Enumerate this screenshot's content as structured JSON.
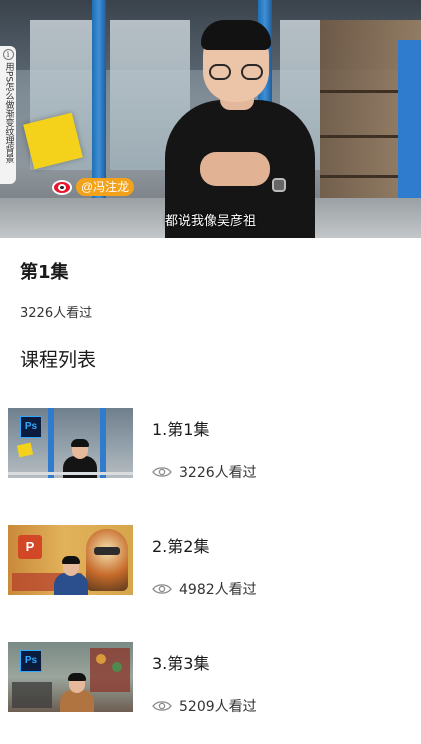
{
  "video": {
    "side_tag": "用PS怎么做渐变纹理背景",
    "watermark": "@冯注龙",
    "subtitle": "都说我像吴彦祖",
    "colors": {
      "pillar": "#2f7ccf",
      "weibo_red": "#e6162d",
      "watermark_bg": "#f3a21a"
    }
  },
  "current_episode": {
    "title": "第1集",
    "views": "3226人看过"
  },
  "section_title": "课程列表",
  "episodes": [
    {
      "title": "1.第1集",
      "views": "3226人看过",
      "thumb_icon": "photoshop-icon",
      "thumb_icon_text": "Ps"
    },
    {
      "title": "2.第2集",
      "views": "4982人看过",
      "thumb_icon": "powerpoint-icon",
      "thumb_icon_text": "P"
    },
    {
      "title": "3.第3集",
      "views": "5209人看过",
      "thumb_icon": "photoshop-icon",
      "thumb_icon_text": "Ps"
    }
  ]
}
